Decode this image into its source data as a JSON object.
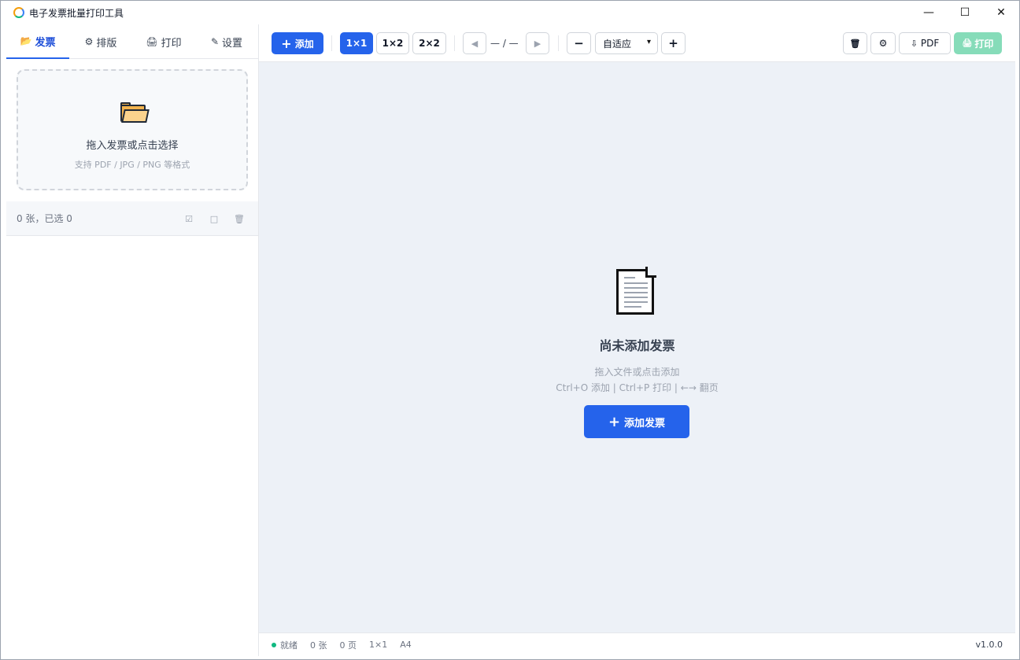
{
  "window": {
    "title": "电子发票批量打印工具",
    "controls": [
      "—",
      "☐",
      "✕"
    ]
  },
  "sidebar": {
    "tabs": [
      {
        "icon": "📂",
        "label": "发票"
      },
      {
        "icon": "⚙",
        "label": "排版"
      },
      {
        "icon": "🖨",
        "label": "打印"
      },
      {
        "icon": "✎",
        "label": "设置"
      }
    ],
    "dropzone": {
      "title": "拖入发票或点击选择",
      "subtitle": "支持 PDF / JPG / PNG 等格式"
    },
    "list": {
      "count_text": "0 张，已选 0",
      "actions": [
        "☑",
        "□",
        "🗑"
      ]
    }
  },
  "toolbar": {
    "add_label": "添加",
    "layouts": [
      "1×1",
      "1×2",
      "2×2"
    ],
    "prev": "◀",
    "page_indicator": "— / —",
    "next": "▶",
    "zoom_out": "−",
    "zoom_value": "自适应",
    "zoom_in": "+",
    "clear_icon": "🗑",
    "settings_icon": "⚙",
    "pdf_label": "PDF",
    "print_label": "打印"
  },
  "main": {
    "empty_title": "尚未添加发票",
    "empty_hint1": "拖入文件或点击添加",
    "empty_hint2": "Ctrl+O 添加 | Ctrl+P 打印 | ←→ 翻页",
    "add_button": "添加发票"
  },
  "statusbar": {
    "state": "就绪",
    "count": "0 张",
    "pages": "0 页",
    "layout": "1×1",
    "paper": "A4",
    "version": "v1.0.0"
  },
  "colors": {
    "primary": "#2563eb",
    "print_disabled": "#86dcb9",
    "main_bg": "#edf1f7",
    "status_ok": "#10b981"
  }
}
